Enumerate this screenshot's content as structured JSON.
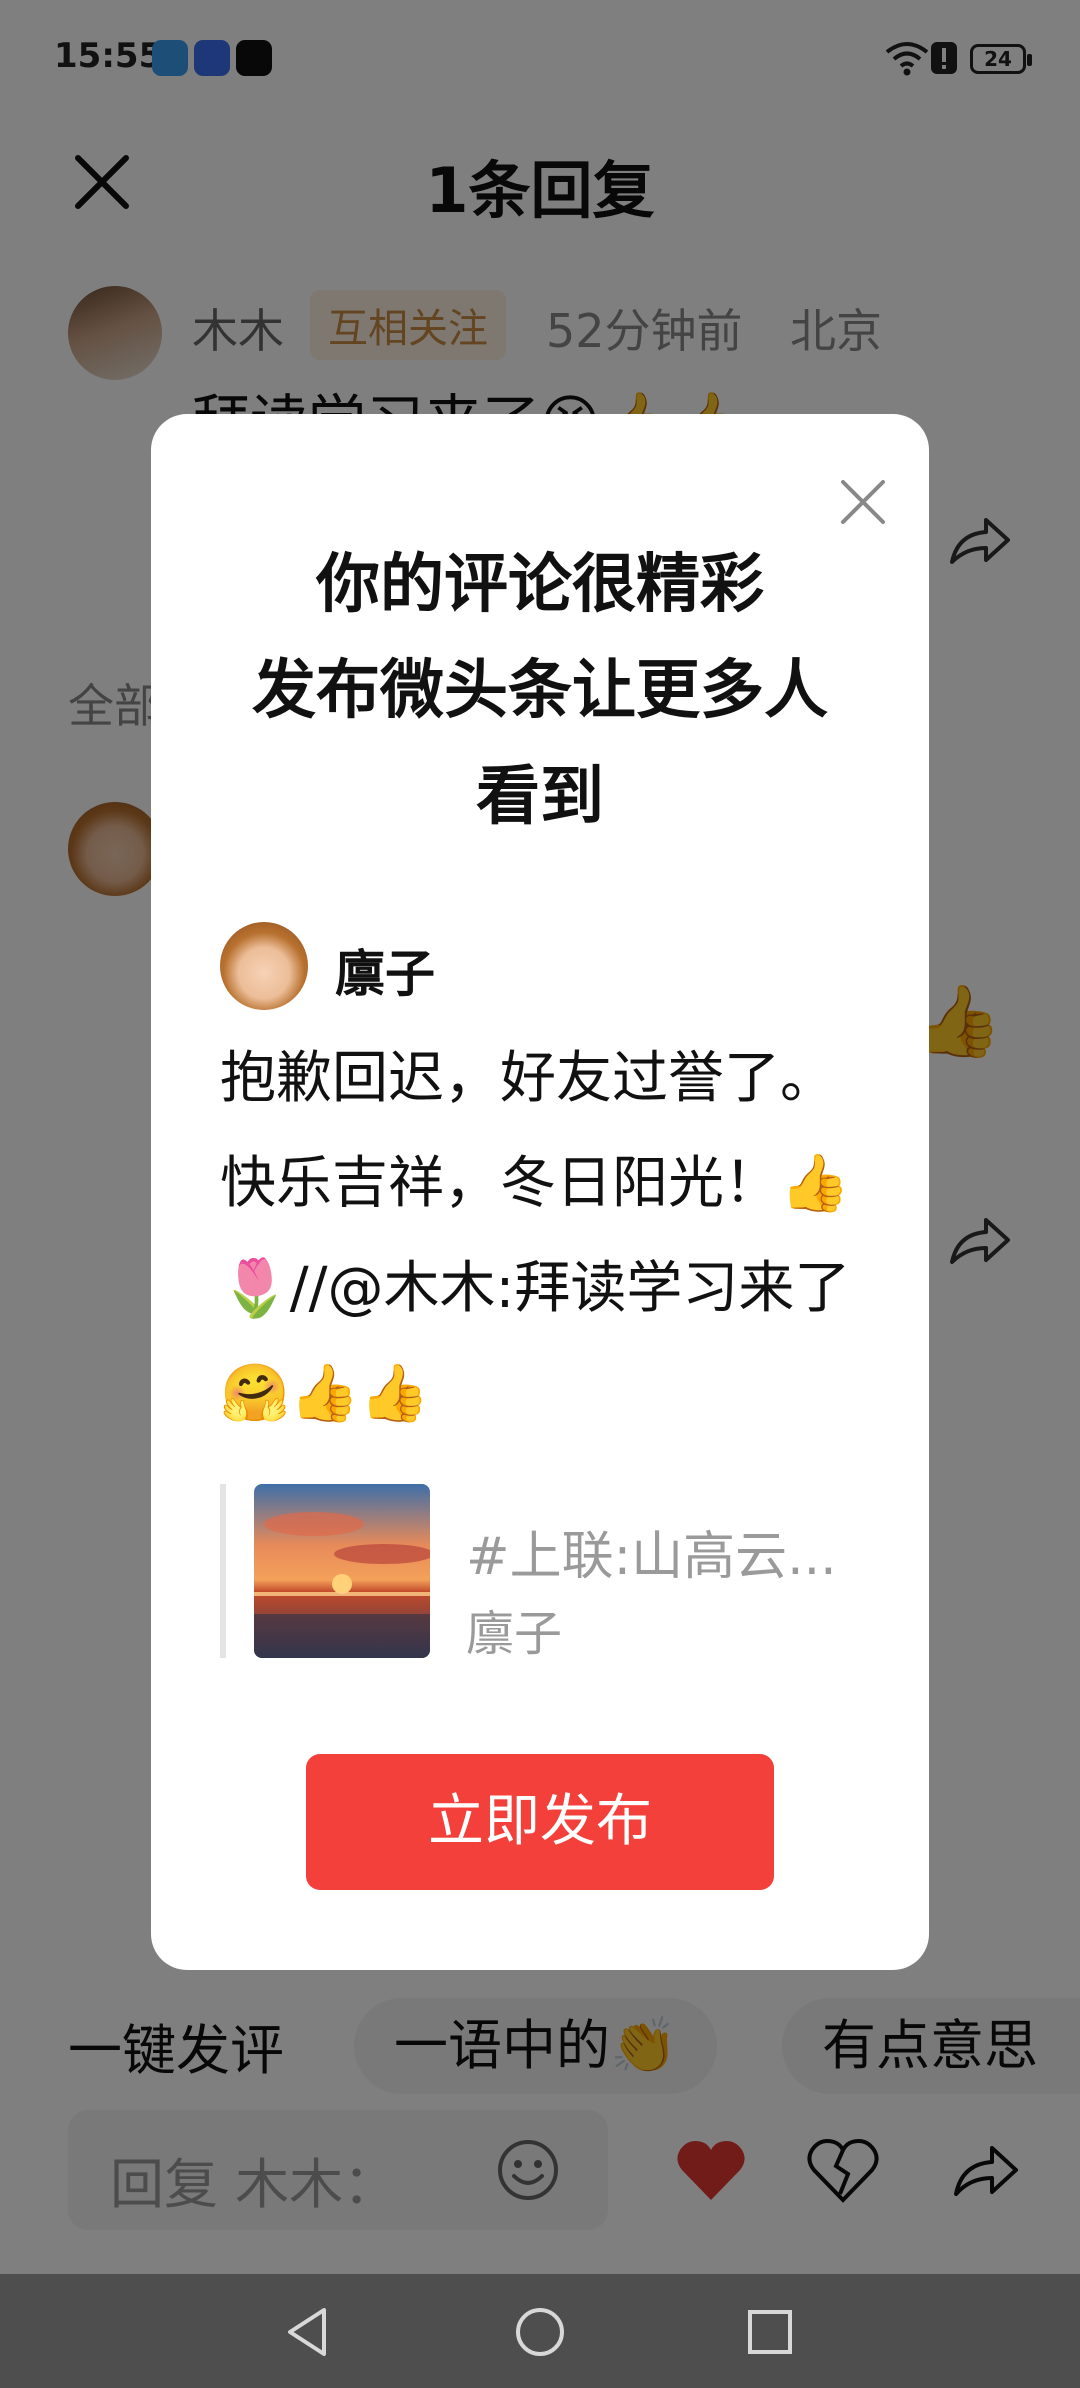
{
  "status_bar": {
    "time": "15:55",
    "battery": "24"
  },
  "page": {
    "title": "1条回复",
    "comment": {
      "author": "木木",
      "badge": "互相关注",
      "time_ago": "52分钟前",
      "location": "北京",
      "text_partial": "拜读学习来了😝👍👍"
    },
    "section_label_partial": "全部"
  },
  "quick_comments": {
    "label": "一键发评",
    "chips": [
      "一语中的👏",
      "有点意思"
    ]
  },
  "reply_bar": {
    "placeholder": "回复 木木："
  },
  "dialog": {
    "title_line1": "你的评论很精彩",
    "title_line2": "发布微头条让更多人",
    "title_line3": "看到",
    "author": "廪子",
    "body": "抱歉回迟，好友过誉了。快乐吉祥，冬日阳光！👍🌷//@木木:拜读学习来了🤗👍👍",
    "quote": {
      "title": "#上联:山高云...",
      "author": "廪子"
    },
    "publish_button": "立即发布"
  },
  "colors": {
    "accent_red": "#f3403b",
    "badge_bg": "#fdf0e2",
    "badge_text": "#c98a45"
  }
}
